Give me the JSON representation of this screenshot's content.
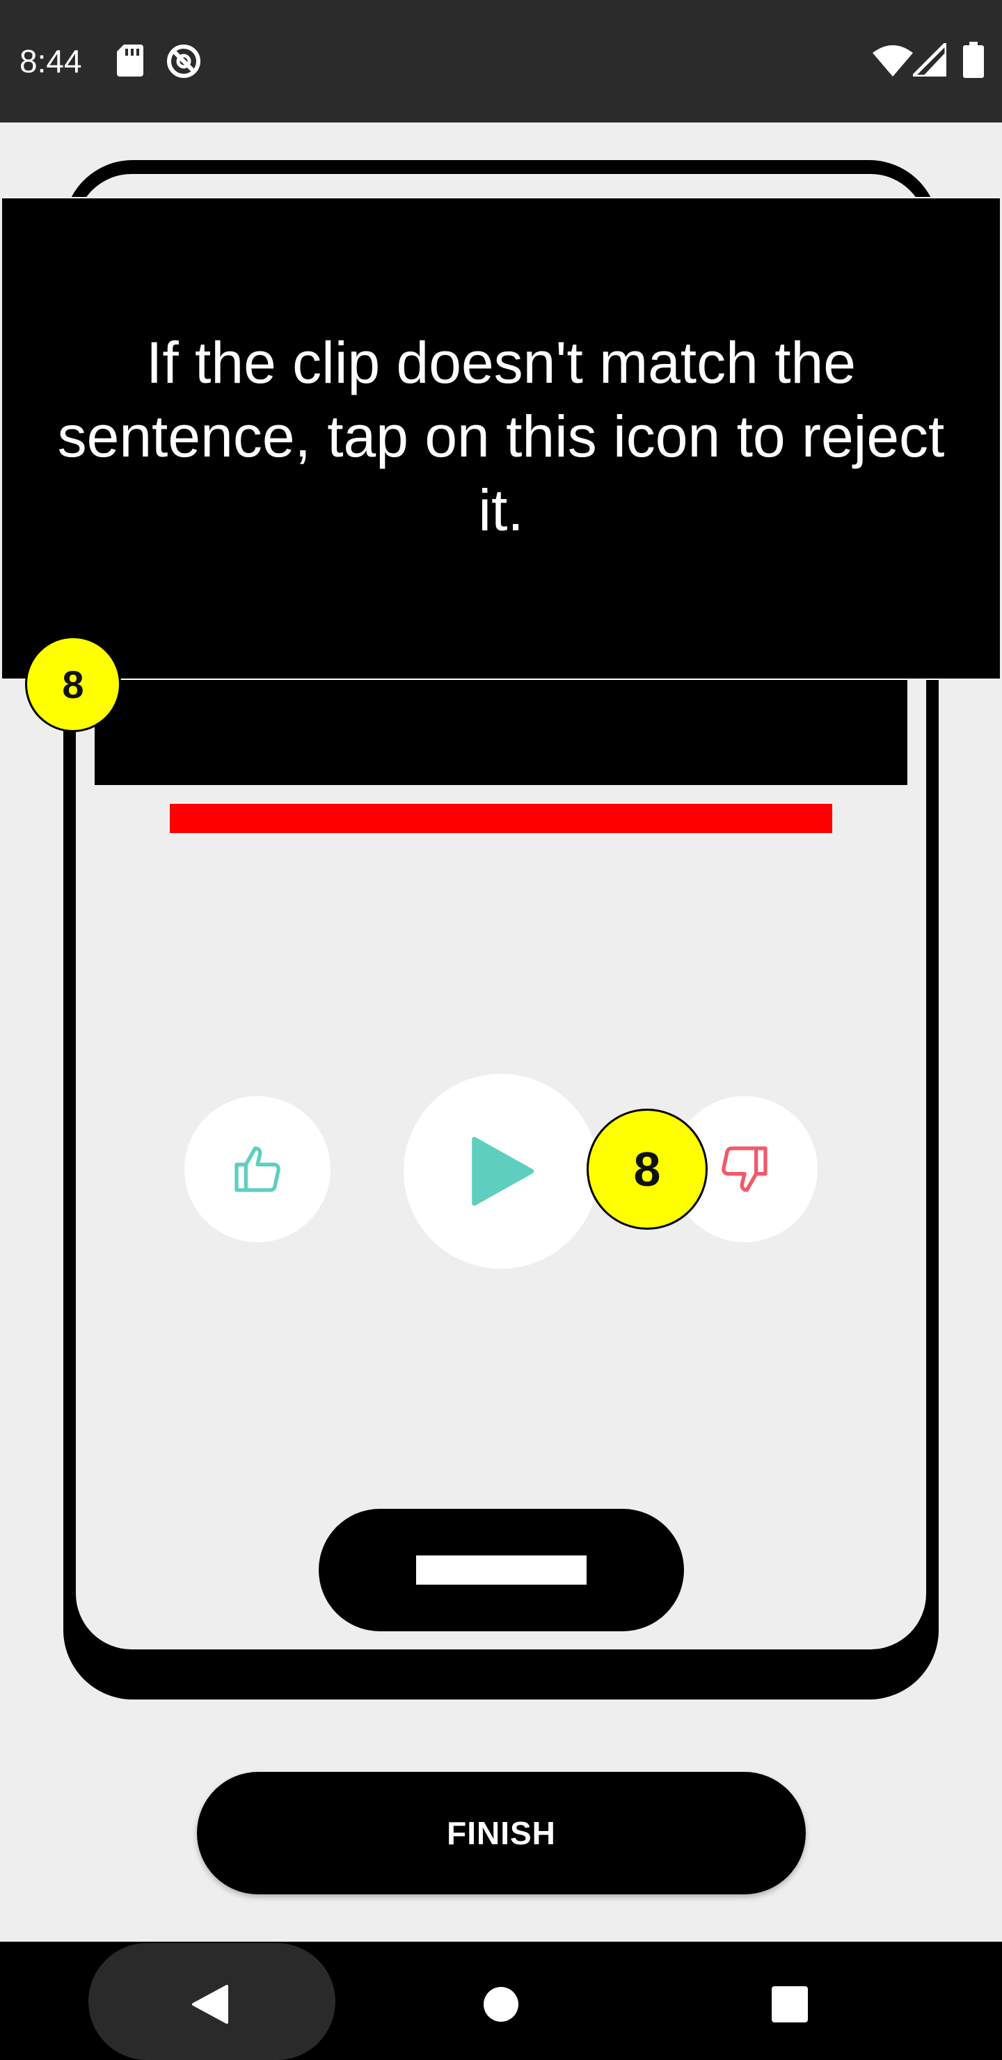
{
  "status_bar": {
    "time": "8:44",
    "icons": [
      "sd-card-icon",
      "data-saver-icon",
      "wifi-icon",
      "signal-icon",
      "battery-icon"
    ]
  },
  "tooltip": {
    "text": "If the clip doesn't match the sentence, tap on this icon to reject it."
  },
  "badges": {
    "step_small": "8",
    "step_large": "8",
    "color": "#ffff00"
  },
  "controls": {
    "approve_icon": "thumbs-up-icon",
    "play_icon": "play-icon",
    "reject_icon": "thumbs-down-icon",
    "approve_color": "#5ecfbf",
    "play_color": "#5ecfbf",
    "reject_color": "#f2586a"
  },
  "finish_button": {
    "label": "FINISH"
  },
  "nav_bar": {
    "icons": [
      "back-icon",
      "home-icon",
      "recents-icon"
    ]
  },
  "colors": {
    "background": "#eeeeee",
    "accent_red": "#ff0000"
  }
}
